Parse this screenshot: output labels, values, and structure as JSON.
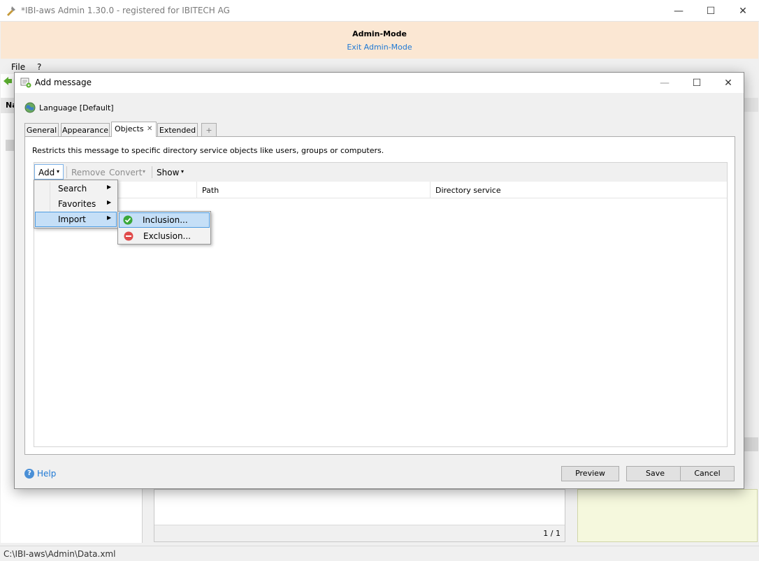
{
  "main_window": {
    "title": "*IBI-aws Admin 1.30.0 - registered for IBITECH AG",
    "admin_mode_label": "Admin-Mode",
    "exit_admin_mode_link": "Exit Admin-Mode",
    "menu": [
      "File",
      "?"
    ],
    "status_path": "C:\\IBI-aws\\Admin\\Data.xml",
    "pager": "1 / 1",
    "list_header_fragment": "Na",
    "controls": {
      "minimize": "—",
      "maximize": "☐",
      "close": "✕"
    }
  },
  "dialog": {
    "title": "Add message",
    "language_label": "Language [Default]",
    "tabs": [
      {
        "label": "General",
        "active": false
      },
      {
        "label": "Appearance",
        "active": false
      },
      {
        "label": "Objects",
        "active": true,
        "closable": true,
        "close_glyph": "✕"
      },
      {
        "label": "Extended",
        "active": false
      },
      {
        "label": "+",
        "active": false
      }
    ],
    "description": "Restricts this message to specific directory service objects like users, groups or computers.",
    "toolbar": {
      "add": "Add",
      "remove": "Remove",
      "convert": "Convert",
      "show": "Show",
      "dropdown_glyph": "▾"
    },
    "grid_columns": [
      "",
      "Path",
      "Directory service"
    ],
    "help_label": "Help",
    "help_glyph": "?",
    "buttons": {
      "preview": "Preview",
      "save": "Save",
      "cancel": "Cancel"
    },
    "controls": {
      "minimize": "—",
      "maximize": "☐",
      "close": "✕"
    }
  },
  "add_menu": {
    "items": [
      {
        "label": "Search",
        "submenu": true,
        "highlighted": false
      },
      {
        "label": "Favorites",
        "submenu": true,
        "highlighted": false
      },
      {
        "label": "Import",
        "submenu": true,
        "highlighted": true
      }
    ],
    "arrow_glyph": "▶"
  },
  "import_submenu": {
    "items": [
      {
        "label": "Inclusion...",
        "icon": "green-check-icon",
        "highlighted": true
      },
      {
        "label": "Exclusion...",
        "icon": "red-minus-icon",
        "highlighted": false
      }
    ]
  },
  "colors": {
    "banner": "#fbe7d3",
    "link": "#1e78d4",
    "highlight": "#c5dff7",
    "highlight_border": "#4d9be0",
    "inclusion": "#3aa83a",
    "exclusion": "#e04a4a"
  }
}
